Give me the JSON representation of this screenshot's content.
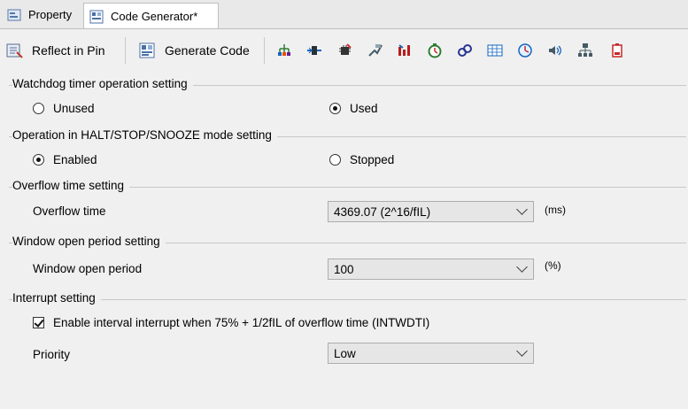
{
  "tabs": [
    {
      "label": "Property",
      "icon": "property-icon"
    },
    {
      "label": "Code Generator*",
      "icon": "code-generator-icon"
    }
  ],
  "toolbar": {
    "reflect_label": "Reflect in Pin",
    "generate_label": "Generate Code",
    "icons": [
      "clock-tree-icon",
      "serial-icon",
      "chip-icon",
      "port-icon",
      "interrupt-icon",
      "timer-icon",
      "link-icon",
      "table-icon",
      "watchdog-icon",
      "sound-icon",
      "network-icon",
      "battery-icon"
    ]
  },
  "watchdog": {
    "title": "Watchdog timer operation setting",
    "unused_label": "Unused",
    "used_label": "Used",
    "selected": "Used"
  },
  "halt": {
    "title": "Operation in HALT/STOP/SNOOZE mode setting",
    "enabled_label": "Enabled",
    "stopped_label": "Stopped",
    "selected": "Enabled"
  },
  "overflow": {
    "title": "Overflow time setting",
    "field_label": "Overflow time",
    "value": "4369.07 (2^16/fIL)",
    "unit": "(ms)"
  },
  "window": {
    "title": "Window open period setting",
    "field_label": "Window open period",
    "value": "100",
    "unit": "(%)"
  },
  "interrupt": {
    "title": "Interrupt setting",
    "checkbox_label": "Enable interval interrupt when 75% + 1/2fIL of overflow time (INTWDTI)",
    "checked": true,
    "priority_label": "Priority",
    "priority_value": "Low"
  }
}
